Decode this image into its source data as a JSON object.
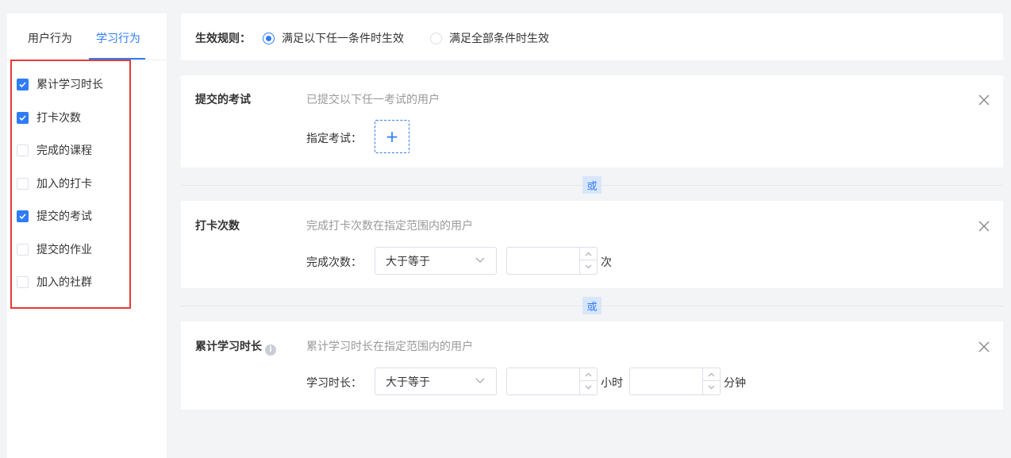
{
  "tabs": [
    {
      "label": "用户行为"
    },
    {
      "label": "学习行为"
    }
  ],
  "conditions": [
    {
      "label": "累计学习时长",
      "checked": true
    },
    {
      "label": "打卡次数",
      "checked": true
    },
    {
      "label": "完成的课程",
      "checked": false
    },
    {
      "label": "加入的打卡",
      "checked": false
    },
    {
      "label": "提交的考试",
      "checked": true
    },
    {
      "label": "提交的作业",
      "checked": false
    },
    {
      "label": "加入的社群",
      "checked": false
    }
  ],
  "rule": {
    "label": "生效规则：",
    "options": [
      {
        "label": "满足以下任一条件时生效",
        "selected": true
      },
      {
        "label": "满足全部条件时生效",
        "selected": false
      }
    ]
  },
  "or_label": "或",
  "exam": {
    "title": "提交的考试",
    "desc": "已提交以下任一考试的用户",
    "field_label": "指定考试：",
    "add_symbol": "+"
  },
  "checkin": {
    "title": "打卡次数",
    "desc": "完成打卡次数在指定范围内的用户",
    "field_label": "完成次数：",
    "operator": "大于等于",
    "value": "",
    "unit": "次"
  },
  "study": {
    "title": "累计学习时长",
    "info_symbol": "i",
    "desc": "累计学习时长在指定范围内的用户",
    "field_label": "学习时长：",
    "operator": "大于等于",
    "hours": "",
    "hours_unit": "小时",
    "minutes": "",
    "minutes_unit": "分钟"
  },
  "colors": {
    "accent": "#2f7cf6",
    "highlight_border": "#e53935"
  }
}
